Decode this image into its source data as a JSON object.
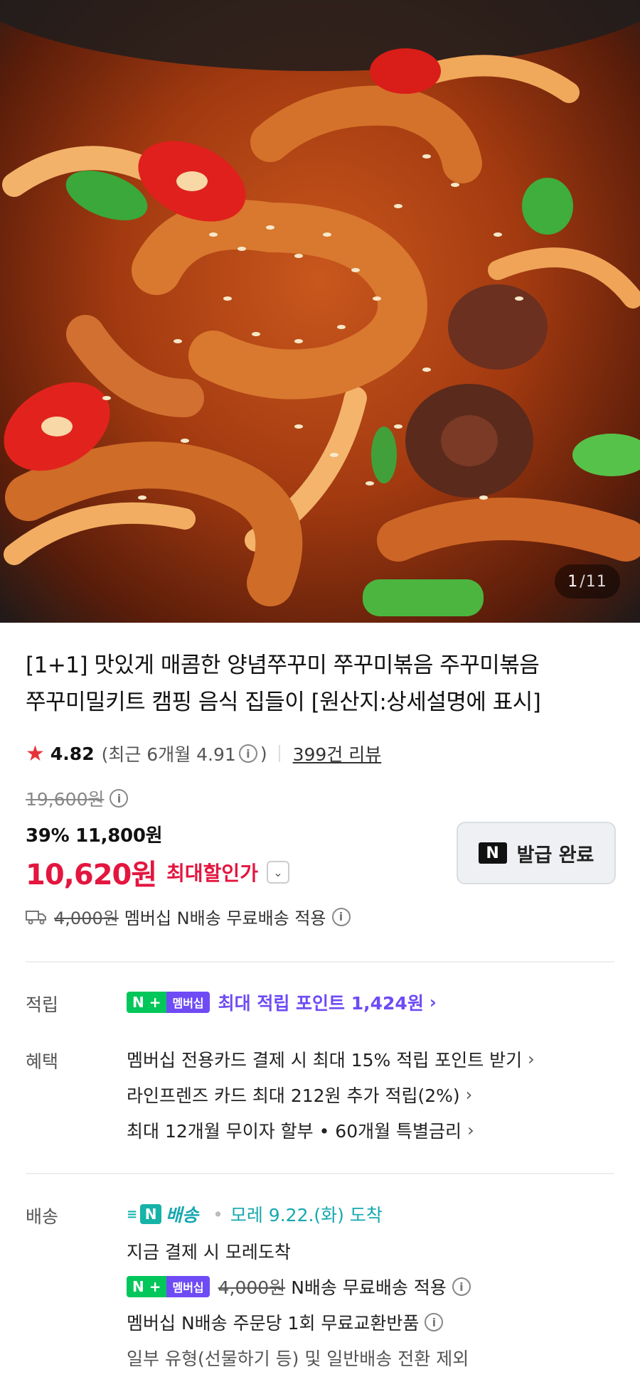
{
  "image_counter": {
    "current": "1",
    "total": "/11"
  },
  "product": {
    "title_line1": "[1+1] 맛있게 매콤한 양념쭈꾸미 쭈꾸미볶음 주꾸미볶음",
    "title_line2": "쭈꾸미밀키트 캠핑 음식 집들이 [원산지:상세설명에 표시]"
  },
  "rating": {
    "score": "4.82",
    "recent_prefix": "(최근 6개월 4.91",
    "recent_suffix": ")",
    "review_link": "399건 리뷰"
  },
  "price": {
    "original": "19,600원",
    "discount_line": "39% 11,800원",
    "final": "10,620원",
    "final_label": "최대할인가"
  },
  "coupon": {
    "badge": "N",
    "label": "발급 완료"
  },
  "shipping_summary": {
    "original_fee": "4,000원",
    "text": "멤버십 N배송 무료배송 적용"
  },
  "points": {
    "label": "적립",
    "badge_n": "N +",
    "badge_membership": "멤버십",
    "text": "최대 적립 포인트 1,424원"
  },
  "benefits": {
    "label": "혜택",
    "items": [
      "멤버십 전용카드 결제 시 최대 15% 적립 포인트 받기",
      "라인프렌즈 카드 최대 212원 추가 적립(2%)",
      "최대 12개월 무이자 할부 • 60개월 특별금리"
    ]
  },
  "delivery": {
    "label": "배송",
    "n_badge": "N",
    "n_text": "배송",
    "arrival": "모레 9.22.(화) 도착",
    "pay_note": "지금 결제 시 모레도착",
    "fee_original": "4,000원",
    "fee_text": "N배송 무료배송 적용",
    "exchange_note": "멤버십 N배송 주문당 1회 무료교환반품",
    "exclusion_note": "일부 유형(선물하기 등) 및 일반배송 전환 제외"
  },
  "colors": {
    "accent_red": "#e3163f",
    "naver_green": "#03c75a",
    "membership_purple": "#6e4bf5",
    "delivery_teal": "#16a8b0"
  }
}
